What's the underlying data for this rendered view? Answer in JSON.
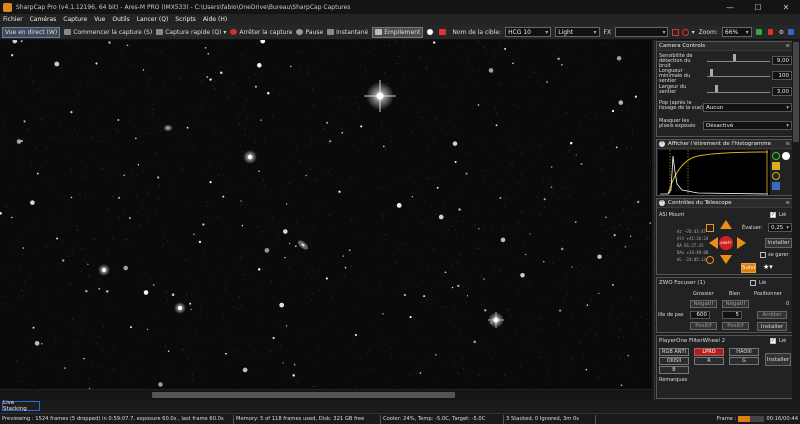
{
  "window": {
    "title": "SharpCap Pro (v4.1.12196, 64 bit) - Ares-M PRO (IMX533) - C:\\Users\\fabio\\OneDrive\\Bureau\\SharpCap Captures"
  },
  "menu": [
    "Fichier",
    "Caméras",
    "Capture",
    "Vue",
    "Outils",
    "Lancer (Q)",
    "Scripts",
    "Aide (H)"
  ],
  "toolbar": {
    "live_view": "Vue en direct (W)",
    "start_capture": "Commencer la capture (S)",
    "quick_capture": "Capture rapide (Q)",
    "stop_capture": "Arrêter la capture",
    "pause": "Pause",
    "snapshot": "Instantané",
    "stacking": "Empilement",
    "target_name_label": "Nom de la cible:",
    "target_name": "HCG 10",
    "light": "Light",
    "fx": "FX",
    "fx_value": "",
    "zoom_label": "Zoom:",
    "zoom": "66%"
  },
  "camera_controls": {
    "title": "Camera Controls",
    "params": [
      {
        "label": "Sensibilité de détection du bruit",
        "value": "9,00"
      },
      {
        "label": "Longueur minimale du sentier",
        "value": "100"
      },
      {
        "label": "Largeur du sentier",
        "value": "3,00"
      },
      {
        "label": "Pop (après le lissage de la vue)",
        "value": "Aucun"
      },
      {
        "label": "Masquer les pixels exposés",
        "value": "Désactivé"
      }
    ]
  },
  "histogram": {
    "title": "Afficher l'étirement de l'histogramme"
  },
  "telescope": {
    "title": "Contrôles du Télescope",
    "mount": "ASI Mount",
    "connected_label": "Lié",
    "coords": [
      "Az  ~76:43:47",
      "Alt  +41:36:24",
      "RA  01:27:35",
      "DAs  +34:49:00",
      "AL  -24:05:13"
    ],
    "evaluate_label": "Évaluer:",
    "evaluate_value": "0,25",
    "install": "Installer",
    "stop": "ARRÊT",
    "park": "se garer",
    "follow": "Suivi"
  },
  "focuser": {
    "title": "ZWO Focuser (1)",
    "connected_label": "Lié",
    "cols": [
      "Grossier",
      "Bien",
      "Positionner"
    ],
    "position": "0",
    "neg": [
      "Négatif",
      "Négatif"
    ],
    "step_label": "ille de pas",
    "step_coarse": "600",
    "step_fine": "5",
    "stop": "Arrêter",
    "pos": [
      "Positif",
      "Positif"
    ],
    "install": "Installer"
  },
  "filterwheel": {
    "title": "PlayerOne FilterWheel 2",
    "connected_label": "Lié",
    "filters": [
      "RGB ANTI",
      "LPRO",
      "HAOIII",
      "OIIISII",
      "R",
      "G",
      "B"
    ],
    "active_filter": "LPRO",
    "install": "Installer",
    "remarks": "Remarques"
  },
  "live_stacking": "Live Stacking",
  "status": {
    "preview": "Previewing : 1524 frames (5 dropped) in 0:59:07.7, exposure 60.0s , last frame 60.0s",
    "memory": "Memory: 5 of 118 frames used, Disk: 321 GB free",
    "cooler": "Cooler: 24%, Temp: -5.0C, Target: -5.0C",
    "stacked": "3 Stacked, 0 Ignored, 3m 0s",
    "frame_label": "Frame :",
    "frame_progress": 0.45,
    "time": "00:16/00:44"
  },
  "colors": {
    "accent": "#e07d10",
    "selection": "#2a6ad0",
    "filter_active": "#c01818"
  }
}
